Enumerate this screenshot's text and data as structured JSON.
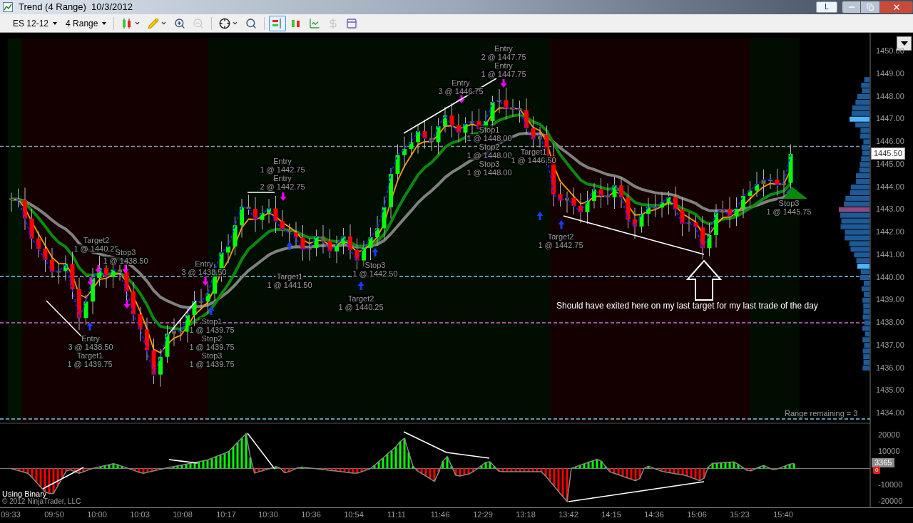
{
  "window": {
    "title": "Trend (4 Range)  10/3/2012",
    "layout_button": "L"
  },
  "toolbar": {
    "instrument": "ES 12-12",
    "period": "4 Range",
    "tools": [
      {
        "kind": "chart-style",
        "menu": true,
        "disabled": false,
        "selected": false
      },
      {
        "kind": "drawing",
        "menu": true,
        "disabled": false,
        "selected": false
      },
      {
        "kind": "zoom-in",
        "menu": false,
        "disabled": false,
        "selected": false
      },
      {
        "kind": "zoom-out",
        "menu": false,
        "disabled": true,
        "selected": false
      },
      {
        "kind": "crosshair",
        "menu": true,
        "disabled": false,
        "selected": false
      },
      {
        "kind": "zoom-box",
        "menu": false,
        "disabled": false,
        "selected": false
      },
      {
        "kind": "order-panel",
        "menu": false,
        "disabled": false,
        "selected": true
      },
      {
        "kind": "candles",
        "menu": false,
        "disabled": false,
        "selected": false
      },
      {
        "kind": "line-chart",
        "menu": false,
        "disabled": false,
        "selected": false
      },
      {
        "kind": "dollar",
        "menu": false,
        "disabled": true,
        "selected": false
      },
      {
        "kind": "properties",
        "menu": false,
        "disabled": false,
        "selected": false
      }
    ]
  },
  "price_chart": {
    "price_ticks": [
      "1450.00",
      "1449.00",
      "1448.00",
      "1447.00",
      "1446.00",
      "1445.00",
      "1444.00",
      "1443.00",
      "1442.00",
      "1441.00",
      "1440.00",
      "1439.00",
      "1438.00",
      "1437.00",
      "1436.00",
      "1435.00",
      "1434.00"
    ],
    "last_price": "1445.50",
    "annotations": [
      {
        "title": "Target2",
        "detail": "1 @ 1440.25"
      },
      {
        "title": "Stop3",
        "detail": "1 @ 1438.50"
      },
      {
        "title": "Entry",
        "detail": "3 @ 1438.50"
      },
      {
        "title": "Target1",
        "detail": "1 @ 1439.75"
      },
      {
        "title": "Entry",
        "detail": "3 @ 1438.50"
      },
      {
        "title": "Stop1",
        "detail": "1 @ 1439.75"
      },
      {
        "title": "Stop2",
        "detail": "1 @ 1439.75"
      },
      {
        "title": "Stop3",
        "detail": "1 @ 1439.75"
      },
      {
        "title": "Entry",
        "detail": "1 @ 1442.75"
      },
      {
        "title": "Entry",
        "detail": "2 @ 1442.75"
      },
      {
        "title": "Target1",
        "detail": "1 @ 1441.50"
      },
      {
        "title": "Stop3",
        "detail": "1 @ 1442.50"
      },
      {
        "title": "Target2",
        "detail": "1 @ 1440.25"
      },
      {
        "title": "Entry",
        "detail": "3 @ 1446.75"
      },
      {
        "title": "Entry",
        "detail": "2 @ 1447.75"
      },
      {
        "title": "Entry",
        "detail": "1 @ 1447.75"
      },
      {
        "title": "Stop1",
        "detail": "1 @ 1448.00"
      },
      {
        "title": "Stop2",
        "detail": "1 @ 1448.00"
      },
      {
        "title": "Stop3",
        "detail": "1 @ 1448.00"
      },
      {
        "title": "Target1",
        "detail": "1 @ 1446.50"
      },
      {
        "title": "Target2",
        "detail": "1 @ 1442.75"
      },
      {
        "title": "Stop3",
        "detail": "1 @ 1445.75"
      }
    ],
    "note": "Should have exited here on my last target for my last trade of the day",
    "range_remaining": "Range remaining = 3"
  },
  "indicator": {
    "ticks": [
      "20000",
      "10000",
      "-10000",
      "-20000"
    ],
    "last_value": "3365",
    "zero_marker": "0",
    "label": "Using Binary"
  },
  "copyright": "© 2012 NinjaTrader, LLC",
  "time_axis": [
    "09:33",
    "09:50",
    "10:00",
    "10:03",
    "10:08",
    "10:17",
    "10:30",
    "10:36",
    "10:54",
    "11:11",
    "11:46",
    "12:29",
    "13:18",
    "13:42",
    "14:15",
    "14:36",
    "15:06",
    "15:23",
    "15:40"
  ]
}
